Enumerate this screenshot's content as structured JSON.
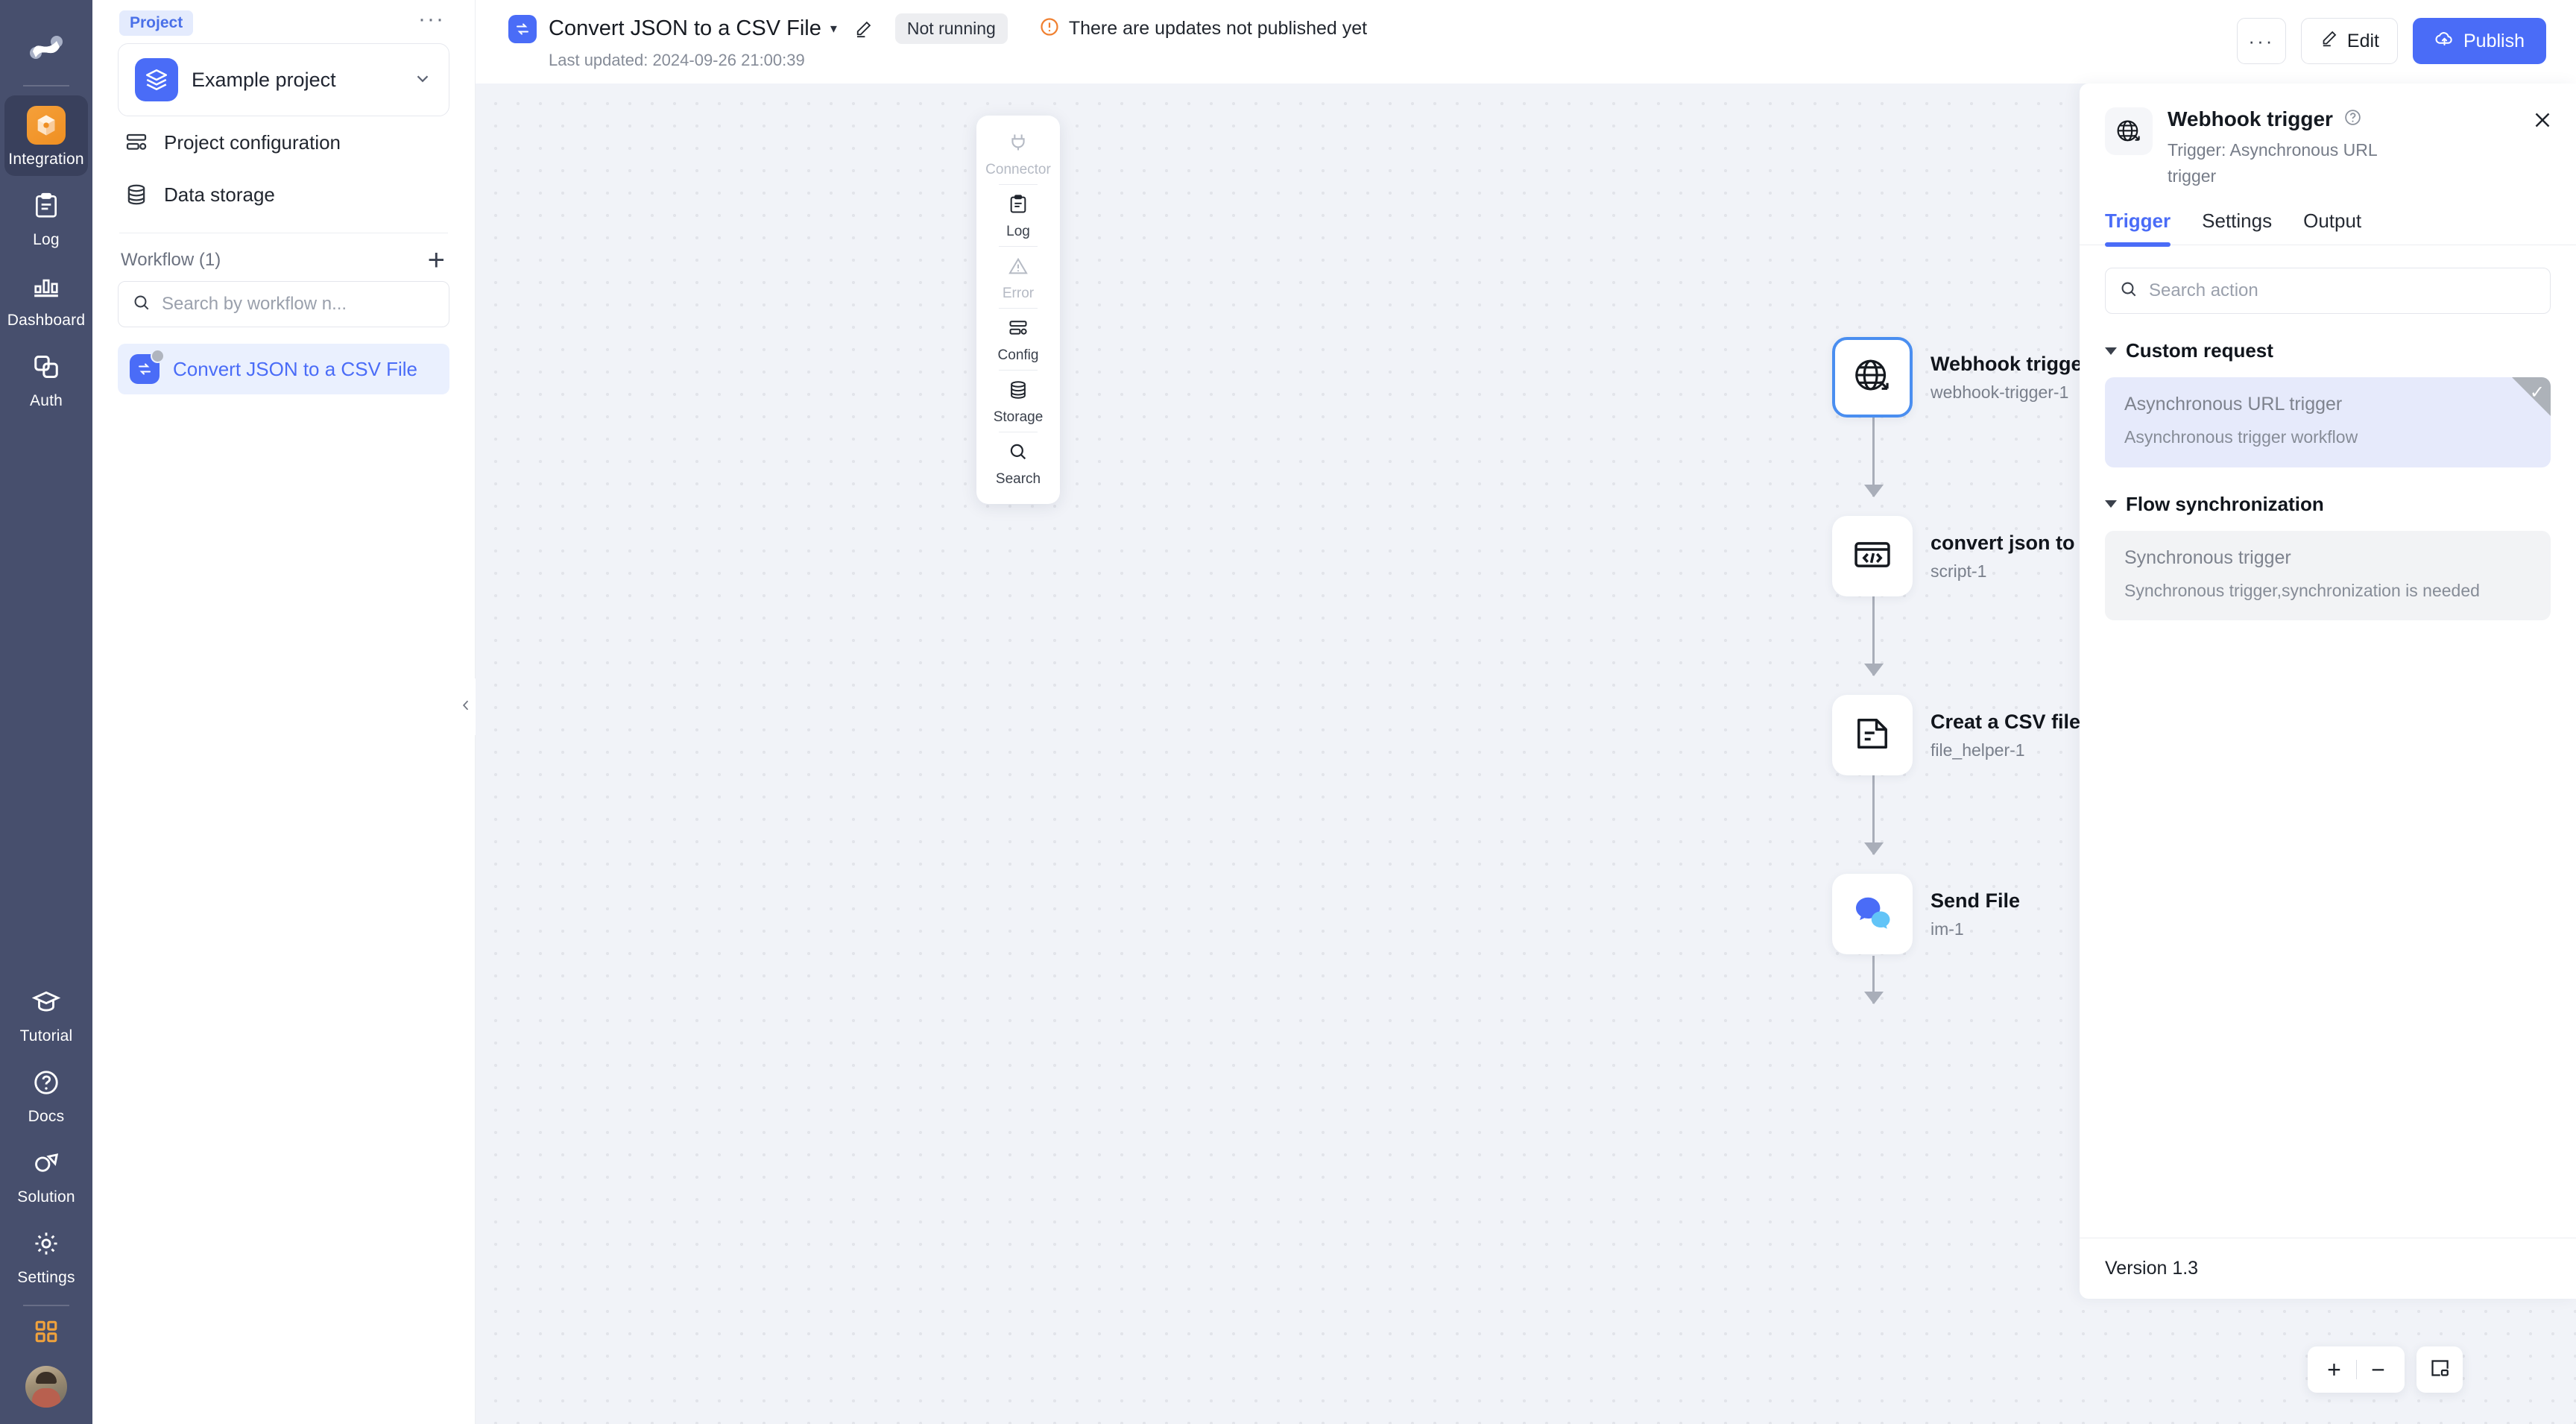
{
  "rail": {
    "logo_name": "app-logo",
    "items": [
      {
        "label": "Integration",
        "icon": "cube-icon",
        "active": true
      },
      {
        "label": "Log",
        "icon": "clipboard-icon",
        "active": false
      },
      {
        "label": "Dashboard",
        "icon": "bar-chart-icon",
        "active": false
      },
      {
        "label": "Auth",
        "icon": "copy-icon",
        "active": false
      }
    ],
    "bottom_items": [
      {
        "label": "Tutorial",
        "icon": "graduation-cap-icon"
      },
      {
        "label": "Docs",
        "icon": "question-circle-icon"
      },
      {
        "label": "Solution",
        "icon": "solution-icon"
      },
      {
        "label": "Settings",
        "icon": "gear-icon"
      }
    ],
    "apps_icon": "grid-apps-icon",
    "avatar": "user-avatar"
  },
  "sidebar": {
    "chip": "Project",
    "more_label": "···",
    "project": {
      "name": "Example project",
      "icon": "layers-icon",
      "chevron": "chevron-down-icon"
    },
    "nav": [
      {
        "label": "Project configuration",
        "icon": "config-icon"
      },
      {
        "label": "Data storage",
        "icon": "database-icon"
      }
    ],
    "workflow_section": {
      "title": "Workflow (1)",
      "add_label": "+"
    },
    "search": {
      "placeholder": "Search by workflow n...",
      "value": "",
      "icon": "search-icon"
    },
    "workflows": [
      {
        "name": "Convert JSON to a CSV File",
        "icon": "workflow-icon",
        "status_dot": "gray",
        "selected": true
      }
    ],
    "collapse_icon": "chevron-left-icon"
  },
  "topbar": {
    "icon": "workflow-icon",
    "title": "Convert JSON to a CSV File",
    "caret": "▾",
    "pencil_icon": "pencil-icon",
    "status_badge": "Not running",
    "warning": {
      "icon": "alert-circle-icon",
      "text": "There are updates not published yet"
    },
    "last_updated": "Last updated: 2024-09-26 21:00:39",
    "more_label": "···",
    "edit_label": "Edit",
    "publish_label": "Publish",
    "accent": "#4a6cf7"
  },
  "palette": {
    "items": [
      {
        "label": "Connector",
        "icon": "plug-icon",
        "dim": true
      },
      {
        "label": "Log",
        "icon": "clipboard-icon",
        "dim": false
      },
      {
        "label": "Error",
        "icon": "warning-triangle-icon",
        "dim": true
      },
      {
        "label": "Config",
        "icon": "config-icon",
        "dim": false
      },
      {
        "label": "Storage",
        "icon": "database-icon",
        "dim": false
      },
      {
        "label": "Search",
        "icon": "search-icon",
        "dim": false
      }
    ]
  },
  "canvas": {
    "nodes": [
      {
        "title": "Webhook trigger",
        "subtitle": "webhook-trigger-1",
        "icon": "globe-arrow-icon",
        "selected": true
      },
      {
        "title": "convert json to csv st...",
        "subtitle": "script-1",
        "icon": "code-icon",
        "selected": false
      },
      {
        "title": "Creat a CSV file",
        "subtitle": "file_helper-1",
        "icon": "document-icon",
        "selected": false
      },
      {
        "title": "Send File",
        "subtitle": "im-1",
        "icon": "chat-bubbles-icon",
        "selected": false
      }
    ],
    "zoom_in": "+",
    "zoom_out": "−",
    "fit_icon": "fit-view-icon"
  },
  "right_panel": {
    "icon": "globe-arrow-icon",
    "title": "Webhook trigger",
    "help_icon": "question-circle-icon",
    "subtitle": "Trigger: Asynchronous URL trigger",
    "close_icon": "close-icon",
    "tabs": [
      {
        "label": "Trigger",
        "active": true
      },
      {
        "label": "Settings",
        "active": false
      },
      {
        "label": "Output",
        "active": false
      }
    ],
    "search": {
      "placeholder": "Search action",
      "value": "",
      "icon": "search-icon"
    },
    "groups": [
      {
        "name": "Custom request",
        "options": [
          {
            "title": "Asynchronous URL trigger",
            "desc": "Asynchronous trigger workflow",
            "selected": true
          }
        ]
      },
      {
        "name": "Flow synchronization",
        "options": [
          {
            "title": "Synchronous trigger",
            "desc": "Synchronous trigger,synchronization is needed",
            "selected": false
          }
        ]
      }
    ],
    "version": "Version 1.3"
  }
}
